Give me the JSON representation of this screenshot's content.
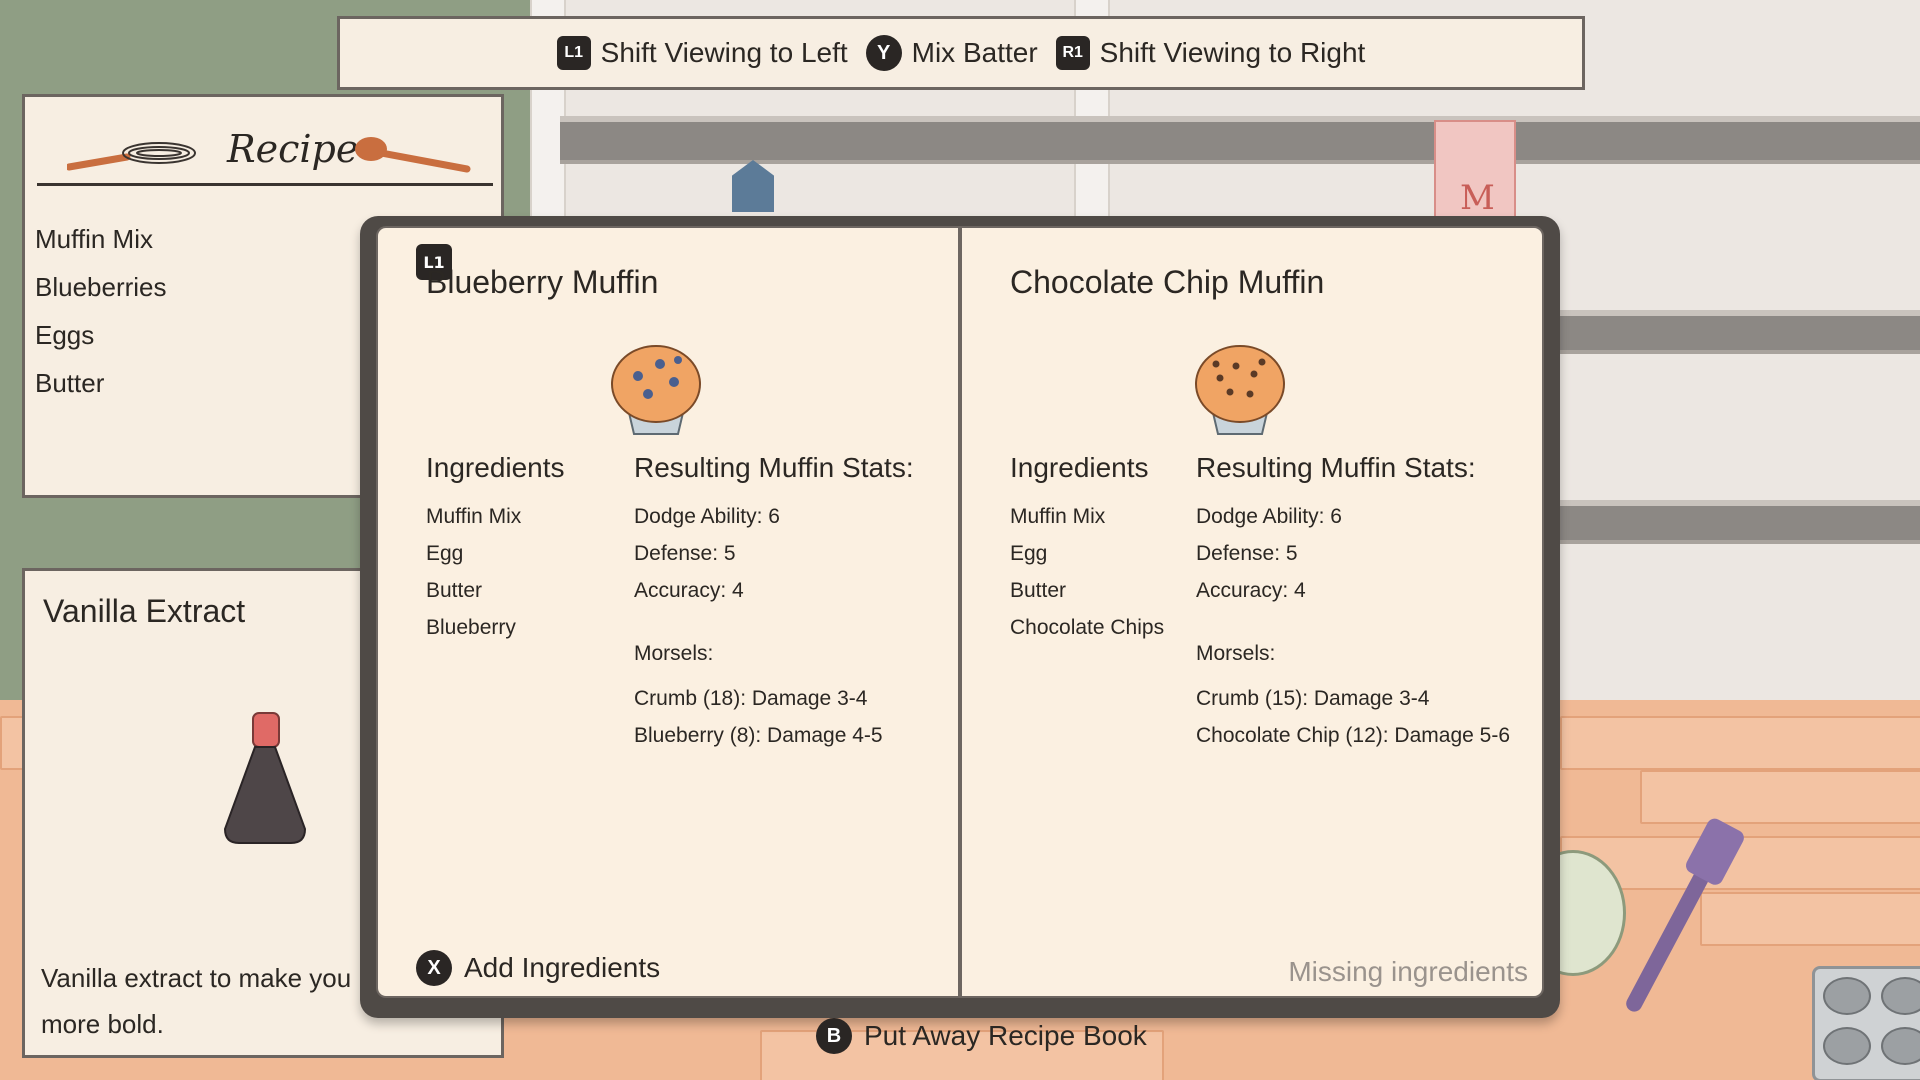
{
  "topbar": {
    "hints": [
      {
        "button": "L1",
        "label": "Shift Viewing to Left"
      },
      {
        "button": "Y",
        "label": "Mix Batter"
      },
      {
        "button": "R1",
        "label": "Shift Viewing to Right"
      }
    ]
  },
  "recipe_card": {
    "title": "Recipe",
    "items": [
      "Muffin Mix",
      "Blueberries",
      "Eggs",
      "Butter"
    ]
  },
  "vanilla_card": {
    "title": "Vanilla Extract",
    "description": "Vanilla extract to make you more bold."
  },
  "book": {
    "tab_button": "L1",
    "left": {
      "name": "Blueberry Muffin",
      "ingredients_title": "Ingredients",
      "ingredients": [
        "Muffin Mix",
        "Egg",
        "Butter",
        "Blueberry"
      ],
      "stats_title": "Resulting Muffin Stats:",
      "stats": [
        "Dodge Ability: 6",
        "Defense: 5",
        "Accuracy: 4"
      ],
      "morsels_label": "Morsels:",
      "morsels": [
        "Crumb (18): Damage 3-4",
        "Blueberry (8): Damage 4-5"
      ],
      "action_button": "X",
      "action_label": "Add Ingredients"
    },
    "right": {
      "name": "Chocolate Chip Muffin",
      "ingredients_title": "Ingredients",
      "ingredients": [
        "Muffin Mix",
        "Egg",
        "Butter",
        "Chocolate Chips"
      ],
      "stats_title": "Resulting Muffin Stats:",
      "stats": [
        "Dodge Ability: 6",
        "Defense: 5",
        "Accuracy: 4"
      ],
      "morsels_label": "Morsels:",
      "morsels": [
        "Crumb (15): Damage 3-4",
        "Chocolate Chip (12): Damage 5-6"
      ],
      "status": "Missing ingredients"
    }
  },
  "bottom_hint": {
    "button": "B",
    "label": "Put Away Recipe Book"
  },
  "scene": {
    "milk_letter": "M"
  },
  "colors": {
    "page": "#fbf0e1",
    "book_cover": "#4f4a46",
    "button": "#2a2624",
    "muted_text": "#9a938d"
  }
}
